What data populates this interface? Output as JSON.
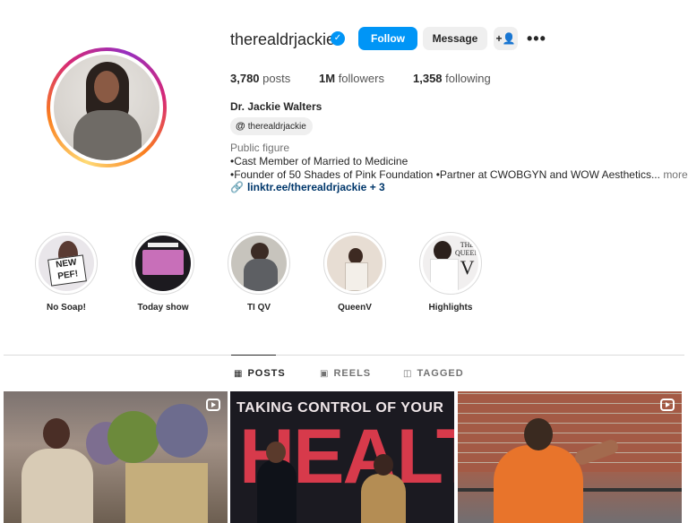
{
  "profile": {
    "username": "therealdrjackie",
    "verified_glyph": "✓",
    "full_name": "Dr. Jackie Walters",
    "threads_handle": "therealdrjackie",
    "threads_icon": "@",
    "category": "Public figure",
    "bio_lines": [
      "•Cast Member of Married to Medicine",
      "•Founder of 50 Shades of Pink Foundation •Partner at CWOBGYN and WOW Aesthetics..."
    ],
    "bio_more": "more",
    "link_text": "linktr.ee/therealdrjackie + 3",
    "link_icon": "🔗"
  },
  "actions": {
    "follow": "Follow",
    "message": "Message",
    "add_user_icon": "+👤",
    "more_icon": "•••"
  },
  "stats": {
    "posts_value": "3,780",
    "posts_label": "posts",
    "followers_value": "1M",
    "followers_label": "followers",
    "following_value": "1,358",
    "following_label": "following"
  },
  "highlights": [
    {
      "label": "No Soap!",
      "sticker": "NEW PEF!"
    },
    {
      "label": "Today show"
    },
    {
      "label": "TI QV"
    },
    {
      "label": "QueenV"
    },
    {
      "label": "Highlights",
      "cover_text_top": "THE",
      "cover_text_mid": "QUEEN",
      "cover_text_big": "V"
    }
  ],
  "tabs": [
    {
      "label": "POSTS",
      "icon": "▦",
      "active": true
    },
    {
      "label": "REELS",
      "icon": "▣",
      "active": false
    },
    {
      "label": "TAGGED",
      "icon": "◫",
      "active": false
    }
  ],
  "posts": [
    {
      "type": "reel"
    },
    {
      "type": "image",
      "headline_top": "TAKING CONTROL OF YOUR",
      "headline_big": "HEALTH"
    },
    {
      "type": "reel"
    }
  ],
  "colors": {
    "accent": "#0095f6",
    "text": "#262626",
    "muted": "#737373",
    "link": "#00376b",
    "divider": "#dbdbdb"
  }
}
